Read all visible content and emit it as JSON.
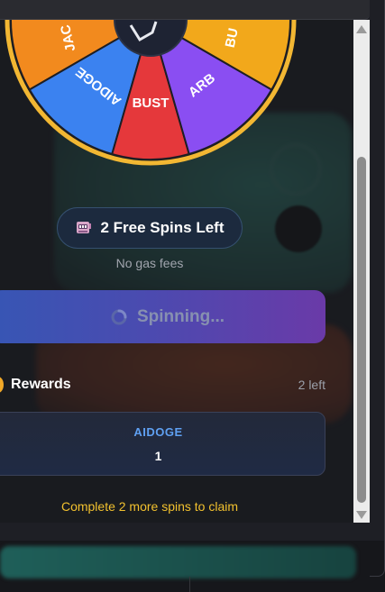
{
  "wheel": {
    "segments": [
      {
        "label": "JAC",
        "color": "#f28a1e"
      },
      {
        "label": "AIDOGE",
        "color": "#3b82f0"
      },
      {
        "label": "BUST",
        "color": "#e5383b"
      },
      {
        "label": "ARB",
        "color": "#8a4ef2"
      },
      {
        "label": "BU",
        "color": "#f2a81b"
      }
    ],
    "rim_color": "#f2b733"
  },
  "spins": {
    "label": "2 Free Spins Left",
    "icon": "slot-machine-icon"
  },
  "gas_note": "No gas fees",
  "spin_button": {
    "label": "Spinning...",
    "icon": "spinner-icon"
  },
  "rewards": {
    "title": "Rewards",
    "icon": "coin-icon",
    "remaining": "2 left",
    "items": [
      {
        "name": "AIDOGE",
        "quantity": "1"
      }
    ]
  },
  "claim_note": "Complete 2 more spins to claim",
  "colors": {
    "accent_blue": "#5fa0f2",
    "claim_yellow": "#f2c12e",
    "button_start": "#3756b4",
    "button_end": "#6a3aa8"
  }
}
